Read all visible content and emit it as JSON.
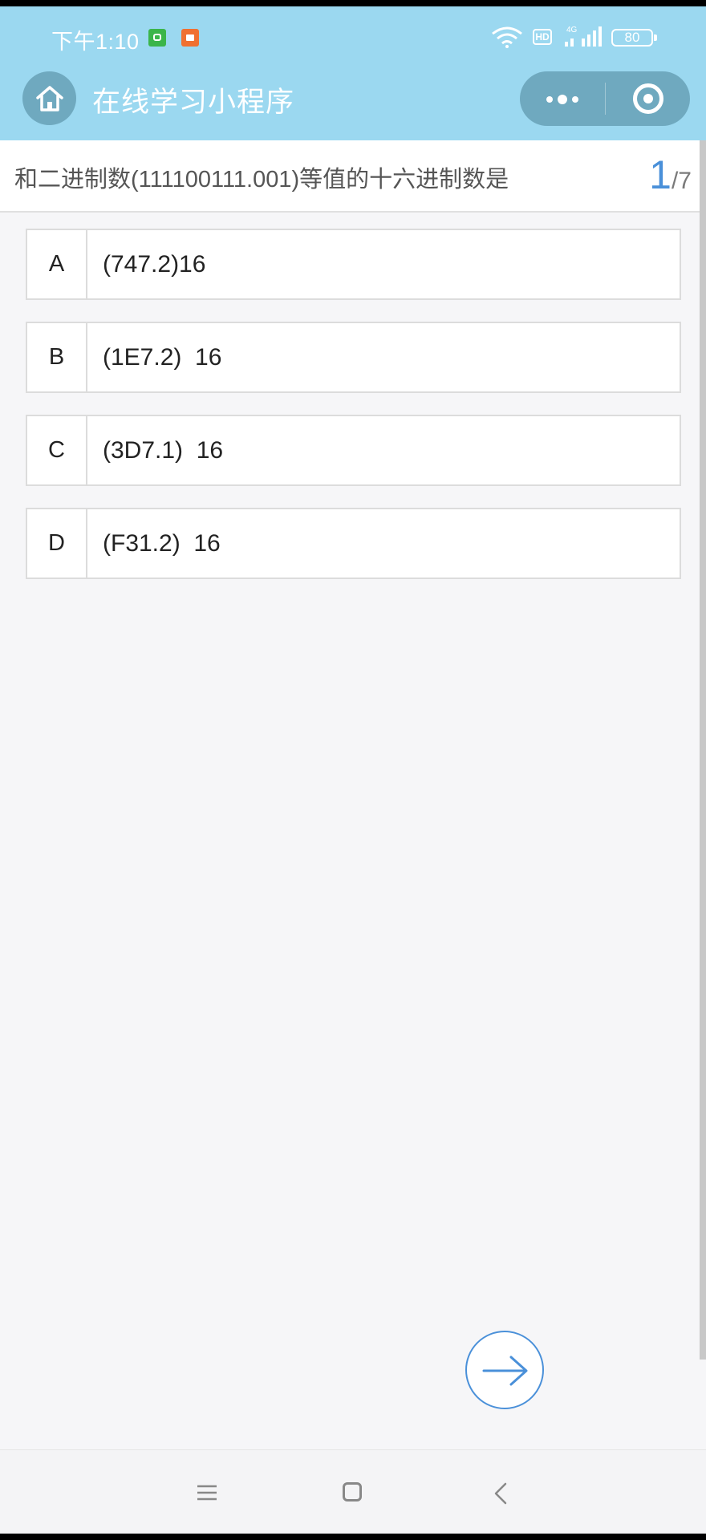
{
  "status_bar": {
    "time": "下午1:10",
    "network": "4G",
    "hd": "HD",
    "battery": "80",
    "icons": [
      "android-notification-icon",
      "video-notification-icon",
      "wifi-icon",
      "hd-icon",
      "signal-icon",
      "battery-icon"
    ]
  },
  "header": {
    "title": "在线学习小程序",
    "background_color": "#9bd8f0",
    "button_color": "#6fa9bf",
    "icons": [
      "home-icon",
      "more-icon",
      "close-target-icon"
    ]
  },
  "question": {
    "text": "和二进制数(111100111.001)等值的十六进制数是",
    "current": "1",
    "total": "/7",
    "accent_color": "#4a90d9"
  },
  "options": [
    {
      "letter": "A",
      "text": "(747.2)16"
    },
    {
      "letter": "B",
      "text": "(1E7.2)  16"
    },
    {
      "letter": "C",
      "text": "(3D7.1)  16"
    },
    {
      "letter": "D",
      "text": "(F31.2)  16"
    }
  ],
  "next": {
    "icon": "arrow-right-icon"
  },
  "nav_bar": {
    "icons": [
      "menu-icon",
      "home-square-icon",
      "back-chevron-icon"
    ]
  }
}
